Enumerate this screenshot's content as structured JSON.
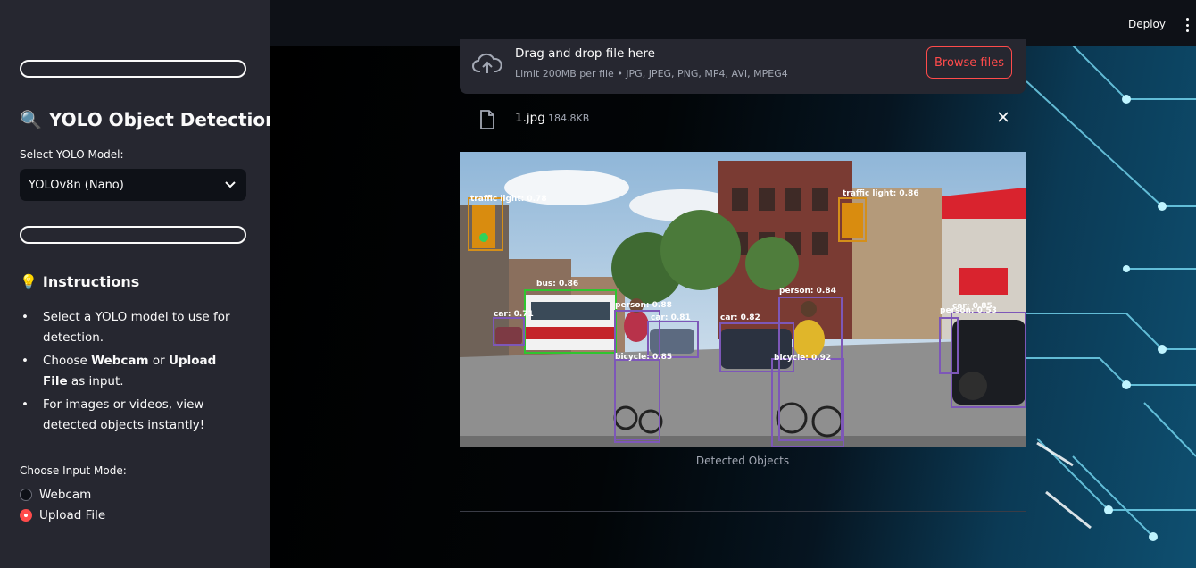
{
  "header": {
    "deploy_label": "Deploy"
  },
  "sidebar": {
    "title": "YOLO Object Detection",
    "title_emoji": "🔍",
    "model_label": "Select YOLO Model:",
    "model_selected": "YOLOv8n (Nano)",
    "instructions_emoji": "💡",
    "instructions_title": "Instructions",
    "instructions": {
      "item1": "Select a YOLO model to use for detection.",
      "item2_pre": "Choose ",
      "item2_b1": "Webcam",
      "item2_mid": " or ",
      "item2_b2": "Upload File",
      "item2_post": " as input.",
      "item3": "For images or videos, view detected objects instantly!"
    },
    "input_mode_label": "Choose Input Mode:",
    "input_mode_options": [
      "Webcam",
      "Upload File"
    ],
    "input_mode_selected": "Upload File"
  },
  "uploader": {
    "drop_title": "Drag and drop file here",
    "drop_subtitle": "Limit 200MB per file • JPG, JPEG, PNG, MP4, AVI, MPEG4",
    "browse_label": "Browse files",
    "file_name": "1.jpg",
    "file_size": "184.8KB"
  },
  "result": {
    "caption": "Detected Objects",
    "detections": {
      "tl1": "traffic light: 0.78",
      "tl2": "traffic light: 0.86",
      "bus": "bus: 0.86",
      "car1": "car: 0.71",
      "person1": "person: 0.88",
      "car2": "car: 0.81",
      "car3": "car: 0.82",
      "person2": "person: 0.84",
      "car4": "car: 0.85",
      "person3": "person: 0.53",
      "bicycle1": "bicycle: 0.85",
      "bicycle2": "bicycle: 0.92"
    }
  },
  "colors": {
    "accent": "#ff4b4b",
    "sidebar_bg": "#262730",
    "app_bg": "#0e1117"
  }
}
